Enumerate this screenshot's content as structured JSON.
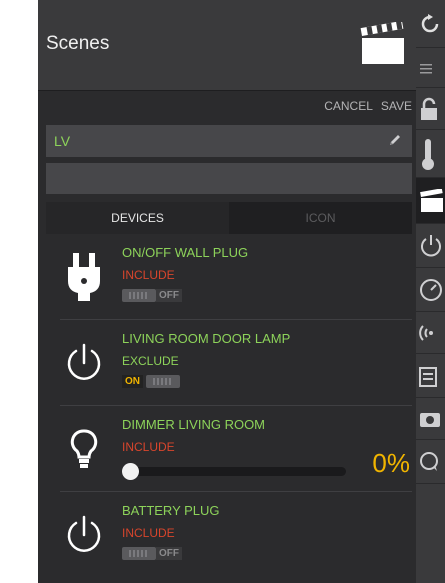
{
  "header": {
    "title": "Scenes",
    "icon": "clapperboard-icon"
  },
  "actions": {
    "cancel": "CANCEL",
    "save": "SAVE"
  },
  "scene": {
    "name": "LV",
    "edit_icon": "pencil-icon"
  },
  "tabs": [
    {
      "label": "DEVICES",
      "active": true
    },
    {
      "label": "ICON",
      "active": false
    }
  ],
  "devices": [
    {
      "name": "ON/OFF WALL PLUG",
      "mode": "INCLUDE",
      "icon": "plug-icon",
      "state": "OFF"
    },
    {
      "name": "LIVING ROOM DOOR LAMP",
      "mode": "EXCLUDE",
      "icon": "power-icon",
      "state": "ON"
    },
    {
      "name": "DIMMER LIVING ROOM",
      "mode": "INCLUDE",
      "icon": "bulb-icon",
      "level_label": "0%",
      "level": 0
    },
    {
      "name": "BATTERY PLUG",
      "mode": "INCLUDE",
      "icon": "power-icon",
      "state": "OFF"
    }
  ],
  "colors": {
    "accent_green": "#8dd35a",
    "include_red": "#d7452c",
    "value_yellow": "#f0b400"
  },
  "rightbar": {
    "icons": [
      "refresh-icon",
      "menu-icon",
      "lock-icon",
      "thermometer-icon",
      "clapperboard-icon",
      "power-icon",
      "gauge-icon",
      "signal-icon",
      "calendar-icon",
      "camera-icon",
      "chat-icon"
    ]
  }
}
